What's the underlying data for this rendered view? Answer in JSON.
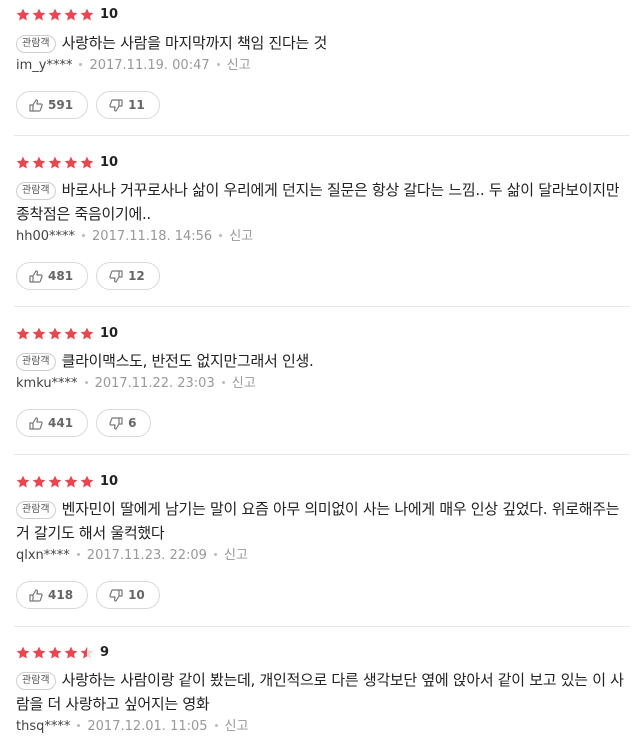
{
  "badge_label": "관람객",
  "report_label": "신고",
  "colors": {
    "star_fill": "#e8474f",
    "star_empty": "#dddddd"
  },
  "reviews": [
    {
      "rating": 10,
      "score": "10",
      "text": "사랑하는 사람을 마지막까지 책임 진다는 것",
      "user": "im_y****",
      "date": "2017.11.19. 00:47",
      "likes": "591",
      "dislikes": "11"
    },
    {
      "rating": 10,
      "score": "10",
      "text": "바로사나 거꾸로사나 삶이 우리에게 던지는 질문은 항상 갈다는 느낌.. 두 삶이 달라보이지만 종착점은 죽음이기에..",
      "user": "hh00****",
      "date": "2017.11.18. 14:56",
      "likes": "481",
      "dislikes": "12"
    },
    {
      "rating": 10,
      "score": "10",
      "text": "클라이맥스도, 반전도 없지만그래서 인생.",
      "user": "kmku****",
      "date": "2017.11.22. 23:03",
      "likes": "441",
      "dislikes": "6"
    },
    {
      "rating": 10,
      "score": "10",
      "text": "벤자민이 딸에게 남기는 말이 요즘 아무 의미없이 사는 나에게 매우 인상 깊었다. 위로해주는거 갈기도 해서 울컥했다",
      "user": "qlxn****",
      "date": "2017.11.23. 22:09",
      "likes": "418",
      "dislikes": "10"
    },
    {
      "rating": 9,
      "score": "9",
      "text": "사랑하는 사람이랑 같이 봤는데, 개인적으로 다른 생각보단 옆에 앉아서 같이 보고 있는 이 사람을 더 사랑하고 싶어지는 영화",
      "user": "thsq****",
      "date": "2017.12.01. 11:05",
      "likes": "",
      "dislikes": ""
    }
  ]
}
